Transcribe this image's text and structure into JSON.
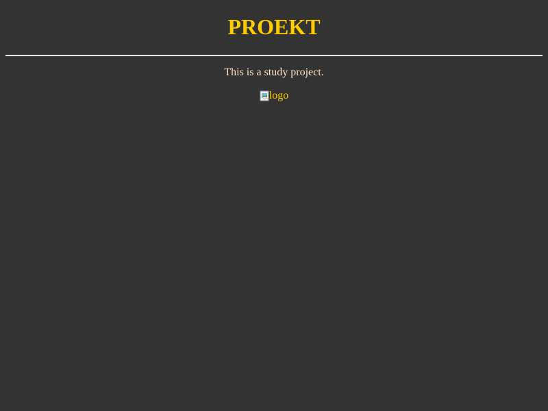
{
  "header": {
    "title": "PROEKT"
  },
  "main": {
    "description": "This is a study project.",
    "logo": {
      "alt": "logo",
      "icon": "broken-image-icon"
    }
  },
  "colors": {
    "background": "#333333",
    "title": "#ffcc00",
    "text": "#ffe4c4",
    "divider": "#e6e6e6"
  }
}
